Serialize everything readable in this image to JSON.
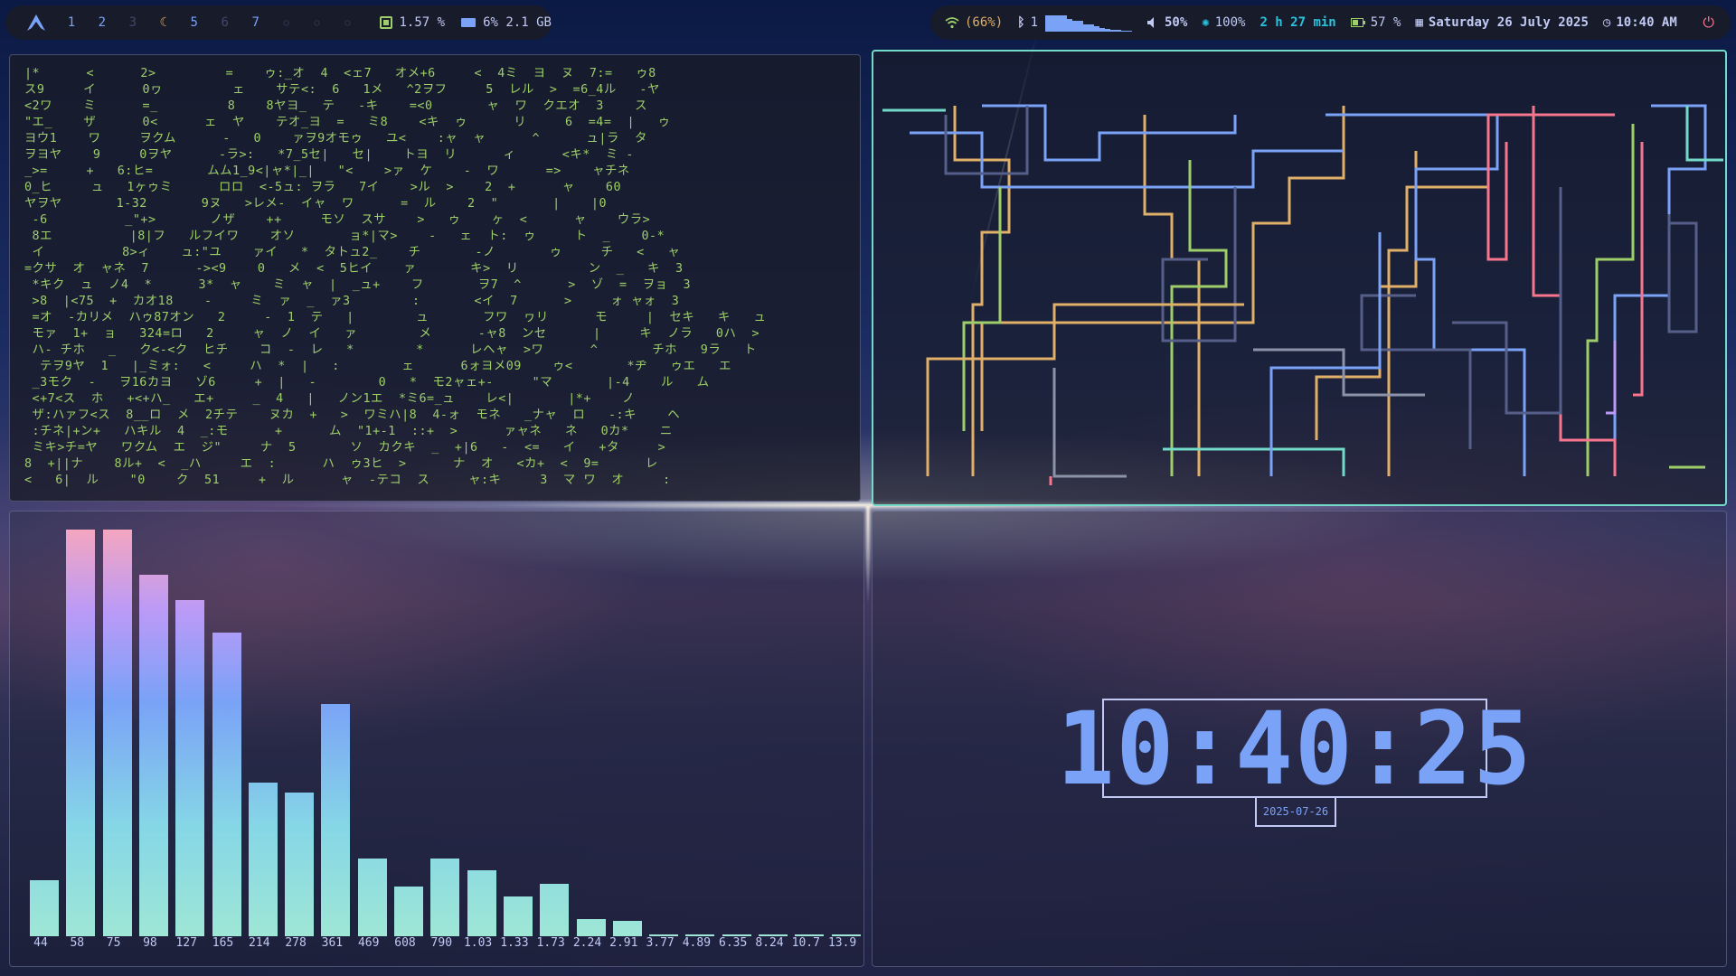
{
  "bar_left": {
    "workspaces": [
      {
        "label": "1",
        "state": "occupied"
      },
      {
        "label": "2",
        "state": "occupied"
      },
      {
        "label": "3",
        "state": "empty"
      },
      {
        "label": "",
        "icon": "moon-icon",
        "state": "active"
      },
      {
        "label": "5",
        "state": "occupied"
      },
      {
        "label": "6",
        "state": "empty"
      },
      {
        "label": "7",
        "state": "occupied"
      },
      {
        "label": "○",
        "state": "empty"
      },
      {
        "label": "○",
        "state": "empty"
      },
      {
        "label": "○",
        "state": "empty"
      }
    ],
    "cpu": "1.57 %",
    "memory": "6% 2.1 GB"
  },
  "bar_right": {
    "wifi": "(66%)",
    "bluetooth": "1",
    "network_graph_levels": [
      0.9,
      0.9,
      0.9,
      0.9,
      0.7,
      0.6,
      0.6,
      0.4,
      0.4,
      0.3,
      0.2,
      0.15,
      0.1,
      0.08,
      0.06,
      0.05
    ],
    "volume": "50%",
    "brightness": "100%",
    "battery_time": "2 h 27 min",
    "battery": "57 %",
    "date": "Saturday 26 July 2025",
    "time": "10:40 AM"
  },
  "matrix": {
    "lines": [
      "|*      <      2>         =    ゥ:_オ  4  <ェ7   オメ+6     <  4ミ  ヨ  ヌ  7:=   ゥ8",
      "ス9     イ      0ヮ         ェ    サテ<:  6   1メ   ^2ヲフ     5  レル  >  =6_4ル   -ヤ",
      "<2ワ    ミ      =_         8    8ヤヨ_  テ   -キ    =<0       ャ  ワ  クエオ  3    ス",
      "\"エ_    ザ      0<      ェ  ヤ    テオ_ヨ  =   ミ8    <キ  ゥ      リ     6  =4=  |   ゥ",
      "ヨウ1    ワ     ヲクム      -   0    ァヲ9オモゥ   ユ<    :ャ  ャ      ^      ュ|ラ  タ",
      "ヲヨヤ    9     0ヲヤ      -ラ>:   *7_5セ|   セ|    トヨ  リ      ィ      <キ*  ミ -",
      "_>=     +   6:ヒ=       ムム1_9<|ャ*|_|   \"<    >ァ  ケ    -  ワ      =>    ャチネ",
      "0_ヒ     ュ   1ヶゥミ      ロロ  <-5ュ: ヲラ   7イ    >ル  >    2  +      ャ    60",
      "ヤヲヤ       1-32       9ヌ   >レメ-  イャ  ワ      =  ル    2  \"       |    |0",
      " -6          _\"+>       ノザ    ++     モソ  スサ    >   ゥ    ヶ  <      ャ    ウラ>",
      " 8エ          |8|フ   ルフイワ    オソ       ョ*|マ>    -   ェ  ト:  ゥ     ト  _    0-*",
      " イ          8>ィ    ュ:\"ユ    ァイ   *  タトュ2_    チ       -ノ       ゥ     チ   <   ャ",
      "=クサ  オ  ャネ  7      -><9    0   メ  <  5ヒイ    ァ       キ>  リ         ン  _   キ  3",
      " *キク  ュ  ノ4  *      3*  ャ    ミ  ャ  |  _ュ+    フ       ヲ7  ^      >  ゾ  =  ヲョ  3",
      " >8  |<75  +  カオ18    -     ミ  ァ  _  ァ3        :       <イ  7      >     ォ ャォ  3",
      " =オ  -カリメ  ハゥ87オン   2     -  1  テ   |        ュ       フワ  ヮリ      モ     |  セキ   キ   ュ",
      " モァ  1+  ョ   324=ロ   2     ャ  ノ  イ   ァ        メ      -ャ8  ンセ      |     キ  ノラ   0ハ  >",
      " ハ- チホ   _   ク<-<ク  ヒチ    コ  -  レ   *        *      レヘャ  >ワ      ^       チホ   9ラ   ト",
      "  テヲ9ヤ  1   |_ミォ:   <     ハ  *  |   :        ェ      6ォヨメ09    ゥ<       *ヂ   ゥエ   エ",
      " _3モク  -   ヲ16カヨ   ゾ6     +  |   -        0   *  モ2ャェ+-     \"マ       |-4    ル   ム",
      " <+7<ス  ホ   +<+ハ_   エ+     _  4   |   ノン1エ  *ミ6=_ュ    レ<|       |*+    ノ",
      " ザ:ハァフ<ス  8__ロ  メ  2チテ    ヌカ  +   >  ワミハ|8  4-ォ  モネ   _ナャ  ロ   -:キ    ヘ",
      " :チネ|+ン+   ハキル  4  _:モ      +      ム  \"1+-1  ::+  >      ァャネ   ネ   0カ*    ニ",
      " ミキ>チ=ヤ   ワクム  エ  ジ\"     ナ  5       ソ  カクキ  _  +|6   -  <=   イ   +タ     >",
      "8  +||ナ    8ル+  <  _ハ     エ  :      ハ  ゥ3ヒ  >      ナ  オ   <カ+  <  9=      レ",
      "<   6|  ル    \"0    ク  51     +  ル      ャ  -テコ  ス     ャ:キ     3  マ ワ  オ     :"
    ]
  },
  "visualizer": {
    "frequency_labels": [
      "44",
      "58",
      "75",
      "98",
      "127",
      "165",
      "214",
      "278",
      "361",
      "469",
      "608",
      "790",
      "1.03",
      "1.33",
      "1.73",
      "2.24",
      "2.91",
      "3.77",
      "4.89",
      "6.35",
      "8.24",
      "10.7",
      "13.9"
    ],
    "levels": [
      0.137,
      1.0,
      1.0,
      0.888,
      0.826,
      0.747,
      0.378,
      0.354,
      0.571,
      0.19,
      0.122,
      0.19,
      0.163,
      0.098,
      0.128,
      0.043,
      0.038,
      0.005,
      0.005,
      0.005,
      0.005,
      0.005,
      0.005
    ]
  },
  "clock": {
    "time": "10:40:25",
    "date": "2025-07-26"
  }
}
